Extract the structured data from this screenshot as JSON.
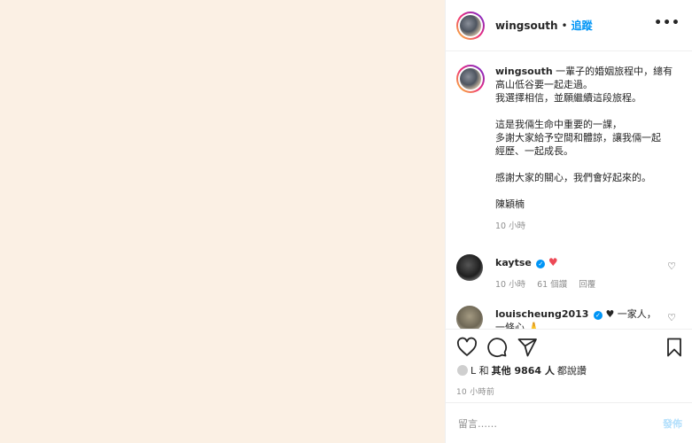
{
  "header": {
    "username": "wingsouth",
    "separator": "•",
    "follow_label": "追蹤",
    "more_label": "•••"
  },
  "caption": {
    "username": "wingsouth",
    "lines": [
      "一輩子的婚姻旅程中，總有",
      "高山低谷要一起走過。",
      "我選擇相信，並願繼續這段旅程。",
      "",
      "這是我倆生命中重要的一課，",
      "多謝大家給予空間和體諒，讓我倆一起",
      "經歷、一起成長。",
      "",
      "感謝大家的關心，我們會好起來的。",
      "",
      "陳穎楠"
    ],
    "time": "10 小時"
  },
  "comments": [
    {
      "username": "kaytse",
      "verified": true,
      "text": "♥",
      "time": "10 小時",
      "likes": "61 個讚",
      "reply": "回覆"
    },
    {
      "username": "louischeung2013",
      "verified": true,
      "text": "♥ 一家人，",
      "text2": "一條心 🙏"
    }
  ],
  "actions": {
    "like_icon": "heart-outline-icon",
    "comment_icon": "comment-bubble-icon",
    "share_icon": "paper-plane-icon",
    "save_icon": "bookmark-icon"
  },
  "likes": {
    "prefix": "L 和",
    "others": "其他 9864 人",
    "suffix": "都說讚"
  },
  "time_ago": "10 小時前",
  "add_comment": {
    "placeholder": "留言……",
    "post_label": "發佈"
  },
  "colors": {
    "media_bg": "#fbf0e4",
    "accent": "#0095f6",
    "heart": "#ed4956"
  }
}
